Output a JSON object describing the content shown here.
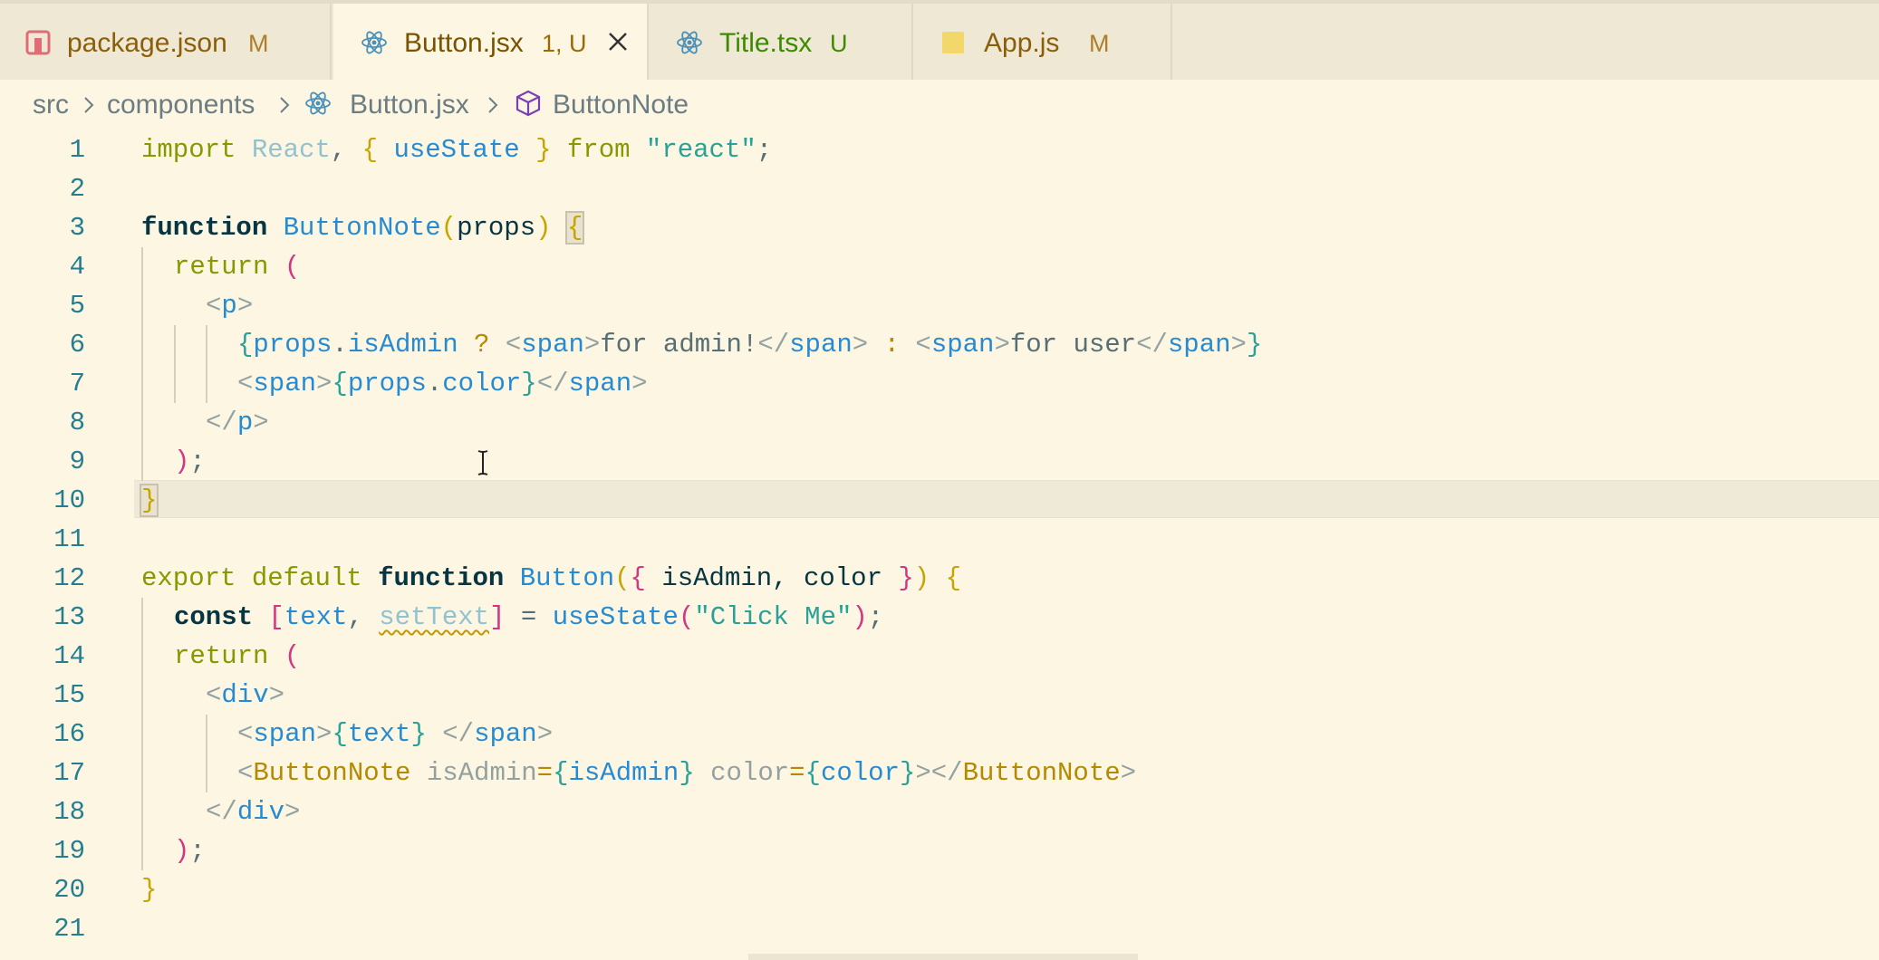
{
  "tabs": [
    {
      "label": "package.json",
      "status": "M",
      "icon": "npm-package-icon",
      "label_color": "#8b5e0a",
      "status_color": "#b07d2a",
      "active": false
    },
    {
      "label": "Button.jsx",
      "status": "1, U",
      "icon": "react-icon",
      "label_color": "#7a5300",
      "status_color": "#9a6a00",
      "active": true,
      "close_icon": "close-icon"
    },
    {
      "label": "Title.tsx",
      "status": "U",
      "icon": "react-icon",
      "label_color": "#3d8a00",
      "status_color": "#3d8a00",
      "active": false
    },
    {
      "label": "App.js",
      "status": "M",
      "icon": "js-file-icon",
      "label_color": "#8b5e0a",
      "status_color": "#b07d2a",
      "active": false
    }
  ],
  "breadcrumb": {
    "items": [
      "src",
      "components",
      "Button.jsx",
      "ButtonNote"
    ],
    "icons": [
      "react-icon",
      "symbol-function-icon"
    ]
  },
  "editor": {
    "line_numbers": [
      "1",
      "2",
      "3",
      "4",
      "5",
      "6",
      "7",
      "8",
      "9",
      "10",
      "11",
      "12",
      "13",
      "14",
      "15",
      "16",
      "17",
      "18",
      "19",
      "20",
      "21"
    ],
    "current_line": "10",
    "lines": {
      "l1": [
        "import",
        " ",
        "React",
        ", ",
        "{",
        " useState ",
        "}",
        " from ",
        "\"react\"",
        ";"
      ],
      "l3": [
        "function",
        " ",
        "ButtonNote",
        "(",
        "props",
        ")",
        " ",
        "{"
      ],
      "l4": [
        "return",
        " ",
        "("
      ],
      "l5": [
        "<",
        "p",
        ">"
      ],
      "l6": [
        "{",
        "props",
        ".",
        "isAdmin",
        " ? ",
        "<",
        "span",
        ">",
        "for admin!",
        "</",
        "span",
        ">",
        " : ",
        "<",
        "span",
        ">",
        "for user",
        "</",
        "span",
        ">",
        "}"
      ],
      "l7": [
        "<",
        "span",
        ">",
        "{",
        "props",
        ".",
        "color",
        "}",
        "</",
        "span",
        ">"
      ],
      "l8": [
        "</",
        "p",
        ">"
      ],
      "l9": [
        ")",
        ";"
      ],
      "l10": [
        "}"
      ],
      "l12": [
        "export",
        " ",
        "default",
        " ",
        "function",
        " ",
        "Button",
        "(",
        "{",
        " isAdmin, color ",
        "}",
        ")",
        " ",
        "{"
      ],
      "l13": [
        "const",
        " ",
        "[",
        "text",
        ", ",
        "setText",
        "]",
        " = ",
        "useState",
        "(",
        "\"Click Me\"",
        ")",
        ";"
      ],
      "l14": [
        "return",
        " ",
        "("
      ],
      "l15": [
        "<",
        "div",
        ">"
      ],
      "l16": [
        "<",
        "span",
        ">",
        "{",
        "text",
        "}",
        " ",
        "</",
        "span",
        ">"
      ],
      "l17": [
        "<",
        "ButtonNote",
        " ",
        "isAdmin",
        "=",
        "{",
        "isAdmin",
        "}",
        " ",
        "color",
        "=",
        "{",
        "color",
        "}",
        ">",
        "</",
        "ButtonNote",
        ">"
      ],
      "l18": [
        "</",
        "div",
        ">"
      ],
      "l19": [
        ")",
        ";"
      ],
      "l20": [
        "}"
      ]
    }
  },
  "cursor": {
    "icon": "text-cursor-icon"
  }
}
